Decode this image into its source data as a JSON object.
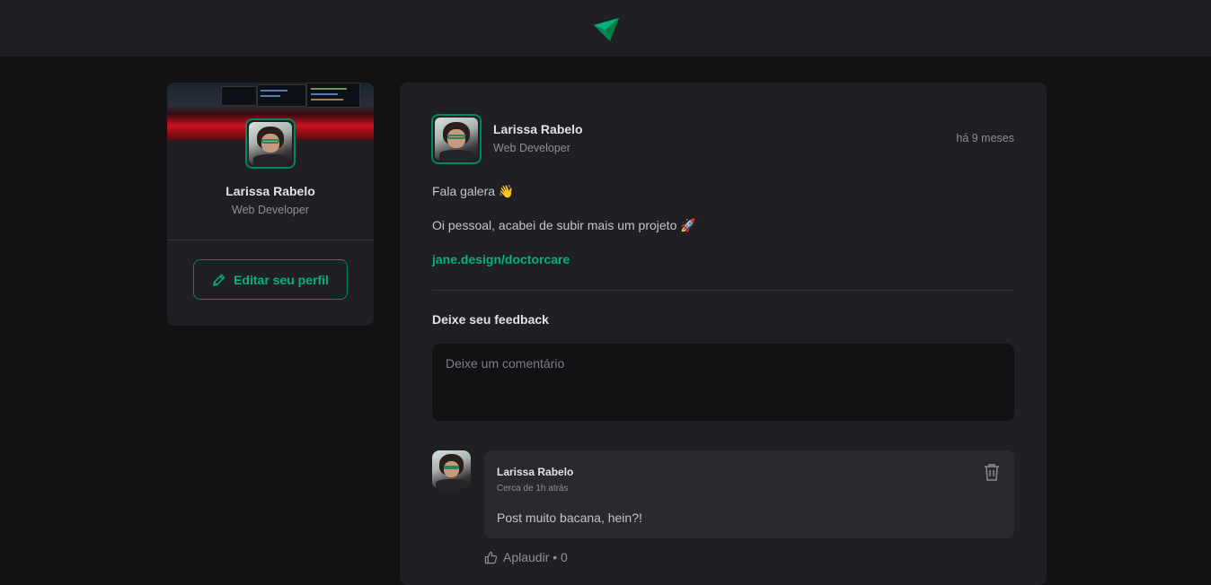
{
  "header": {
    "logo_icon": "ignite-feed-logo-icon"
  },
  "sidebar": {
    "cover_icon": "cover-photo",
    "name": "Larissa Rabelo",
    "role": "Web Developer",
    "edit_label": "Editar seu perfil",
    "edit_icon": "pencil-icon"
  },
  "post": {
    "author": {
      "name": "Larissa Rabelo",
      "role": "Web Developer"
    },
    "published": "há 9 meses",
    "content": {
      "line1": "Fala galera 👋",
      "line2": "Oi pessoal, acabei de subir mais um projeto 🚀",
      "link": "jane.design/doctorcare"
    },
    "feedback_title": "Deixe seu feedback",
    "comment_placeholder": "Deixe um comentário"
  },
  "comment": {
    "author": "Larissa Rabelo",
    "time": "Cerca de 1h atrás",
    "text": "Post muito bacana, hein?!",
    "applaud_label": "Aplaudir • 0",
    "delete_icon": "trash-icon",
    "applaud_icon": "thumbs-up-icon"
  },
  "colors": {
    "accent": "#00B37E",
    "accent_border": "#00875F",
    "background": "#121214",
    "card": "#202024"
  }
}
